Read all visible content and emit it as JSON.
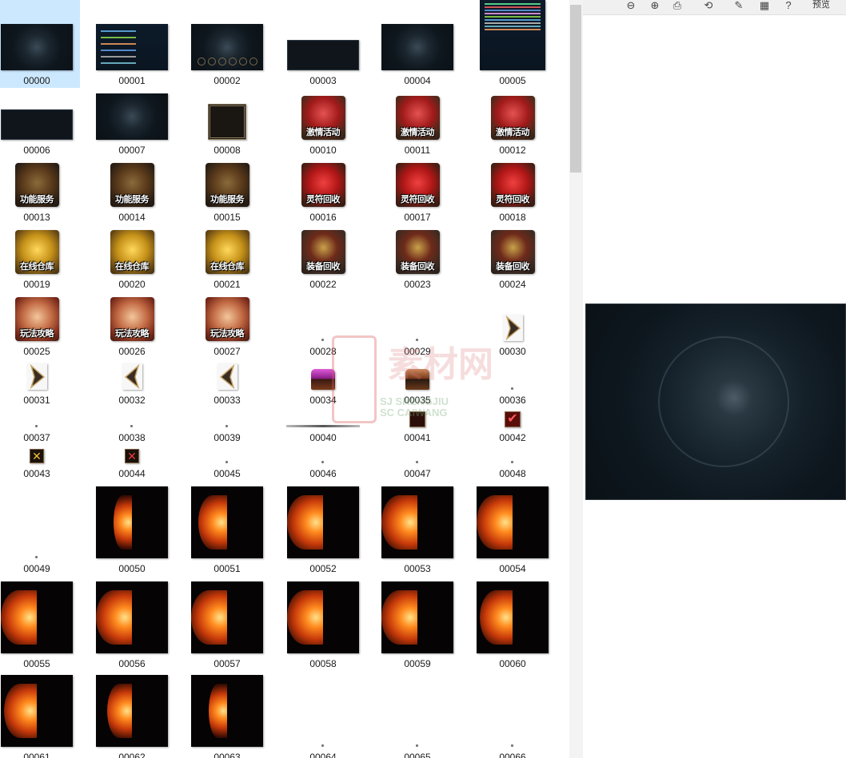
{
  "tiles": [
    {
      "label": "00000",
      "kind": "ui",
      "selected": true
    },
    {
      "label": "00001",
      "kind": "spread"
    },
    {
      "label": "00002",
      "kind": "ui2"
    },
    {
      "label": "00003",
      "kind": "bar"
    },
    {
      "label": "00004",
      "kind": "ui"
    },
    {
      "label": "00005",
      "kind": "spread-tall"
    },
    {
      "label": "00006",
      "kind": "bar"
    },
    {
      "label": "00007",
      "kind": "ui"
    },
    {
      "label": "00008",
      "kind": "frame"
    },
    {
      "label": "00010",
      "kind": "icon",
      "style": "red",
      "caption": "激情活动"
    },
    {
      "label": "00011",
      "kind": "icon",
      "style": "red",
      "caption": "激情活动"
    },
    {
      "label": "00012",
      "kind": "icon",
      "style": "red",
      "caption": "激情活动"
    },
    {
      "label": "00013",
      "kind": "icon",
      "style": "sword",
      "caption": "功能服务"
    },
    {
      "label": "00014",
      "kind": "icon",
      "style": "sword",
      "caption": "功能服务"
    },
    {
      "label": "00015",
      "kind": "icon",
      "style": "sword",
      "caption": "功能服务"
    },
    {
      "label": "00016",
      "kind": "icon",
      "style": "bag",
      "caption": "灵符回收"
    },
    {
      "label": "00017",
      "kind": "icon",
      "style": "bag",
      "caption": "灵符回收"
    },
    {
      "label": "00018",
      "kind": "icon",
      "style": "bag",
      "caption": "灵符回收"
    },
    {
      "label": "00019",
      "kind": "icon",
      "style": "gold",
      "caption": "在线仓库"
    },
    {
      "label": "00020",
      "kind": "icon",
      "style": "gold",
      "caption": "在线仓库"
    },
    {
      "label": "00021",
      "kind": "icon",
      "style": "gold",
      "caption": "在线仓库"
    },
    {
      "label": "00022",
      "kind": "icon",
      "style": "helm",
      "caption": "装备回收"
    },
    {
      "label": "00023",
      "kind": "icon",
      "style": "helm",
      "caption": "装备回收"
    },
    {
      "label": "00024",
      "kind": "icon",
      "style": "helm",
      "caption": "装备回收"
    },
    {
      "label": "00025",
      "kind": "icon",
      "style": "scroll",
      "caption": "玩法攻略"
    },
    {
      "label": "00026",
      "kind": "icon",
      "style": "scroll",
      "caption": "玩法攻略"
    },
    {
      "label": "00027",
      "kind": "icon",
      "style": "scroll",
      "caption": "玩法攻略"
    },
    {
      "label": "00028",
      "kind": "dot"
    },
    {
      "label": "00029",
      "kind": "dot"
    },
    {
      "label": "00030",
      "kind": "arrow-right"
    },
    {
      "label": "00031",
      "kind": "arrow-right"
    },
    {
      "label": "00032",
      "kind": "arrow-left"
    },
    {
      "label": "00033",
      "kind": "arrow-left"
    },
    {
      "label": "00034",
      "kind": "chest-purple"
    },
    {
      "label": "00035",
      "kind": "chest-brown"
    },
    {
      "label": "00036",
      "kind": "dot"
    },
    {
      "label": "00037",
      "kind": "dot"
    },
    {
      "label": "00038",
      "kind": "dot"
    },
    {
      "label": "00039",
      "kind": "dot"
    },
    {
      "label": "00040",
      "kind": "line"
    },
    {
      "label": "00041",
      "kind": "box-dark"
    },
    {
      "label": "00042",
      "kind": "check"
    },
    {
      "label": "00043",
      "kind": "x-gold"
    },
    {
      "label": "00044",
      "kind": "x-red"
    },
    {
      "label": "00045",
      "kind": "dot"
    },
    {
      "label": "00046",
      "kind": "dot"
    },
    {
      "label": "00047",
      "kind": "dot"
    },
    {
      "label": "00048",
      "kind": "dot"
    },
    {
      "label": "00049",
      "kind": "dot"
    },
    {
      "label": "00050",
      "kind": "fire",
      "fill": 0.25
    },
    {
      "label": "00051",
      "kind": "fire",
      "fill": 0.4
    },
    {
      "label": "00052",
      "kind": "fire",
      "fill": 0.5
    },
    {
      "label": "00053",
      "kind": "fire",
      "fill": 0.5
    },
    {
      "label": "00054",
      "kind": "fire",
      "fill": 0.5
    },
    {
      "label": "00055",
      "kind": "fire",
      "fill": 0.5
    },
    {
      "label": "00056",
      "kind": "fire",
      "fill": 0.5
    },
    {
      "label": "00057",
      "kind": "fire",
      "fill": 0.5
    },
    {
      "label": "00058",
      "kind": "fire",
      "fill": 0.5
    },
    {
      "label": "00059",
      "kind": "fire",
      "fill": 0.5
    },
    {
      "label": "00060",
      "kind": "fire",
      "fill": 0.45
    },
    {
      "label": "00061",
      "kind": "fire",
      "fill": 0.45
    },
    {
      "label": "00062",
      "kind": "fire",
      "fill": 0.35
    },
    {
      "label": "00063",
      "kind": "fire",
      "fill": 0.25
    },
    {
      "label": "00064",
      "kind": "dot"
    },
    {
      "label": "00065",
      "kind": "dot"
    },
    {
      "label": "00066",
      "kind": "dot"
    }
  ],
  "preview": {
    "toolbar": [
      {
        "icon": "zoom-out-icon",
        "glyph": "⊖"
      },
      {
        "icon": "zoom-in-icon",
        "glyph": "⊕"
      },
      {
        "icon": "print-icon",
        "glyph": "⎙"
      },
      {
        "icon": "rotate-icon",
        "glyph": "⟲"
      },
      {
        "icon": "edit-icon",
        "glyph": "✎"
      },
      {
        "icon": "apps-icon",
        "glyph": "▦"
      },
      {
        "icon": "help-icon",
        "glyph": "?"
      }
    ],
    "label": "预览"
  },
  "watermark": {
    "text": "素材网",
    "latin_line1": "SJ  SHENGJIU",
    "latin_line2": "SC  CAIWANG"
  }
}
